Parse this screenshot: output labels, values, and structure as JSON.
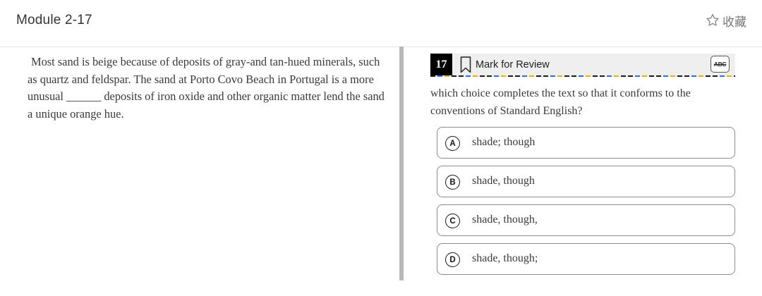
{
  "header": {
    "title": "Module 2-17",
    "favorite_label": "收藏",
    "favorite_icon": "star-outline-icon"
  },
  "passage": {
    "text": "Most sand is beige because of deposits of gray-and tan-hued minerals, such as quartz and feldspar. The sand at Porto Covo Beach in Portugal is a more unusual ______ deposits of iron oxide and other organic matter lend the sand a unique orange hue."
  },
  "question": {
    "number": "17",
    "mark_for_review_label": "Mark for Review",
    "bookmark_icon": "bookmark-outline-icon",
    "abc_label": "ABC",
    "abc_icon": "answer-eliminator-icon",
    "prompt": "which choice completes the text so that it conforms to the conventions of Standard English?",
    "dash_colors": [
      "#1a1a1a",
      "#2d6fcf",
      "#e0b300"
    ],
    "choices": [
      {
        "letter": "A",
        "text": "shade; though"
      },
      {
        "letter": "B",
        "text": "shade, though"
      },
      {
        "letter": "C",
        "text": "shade, though,"
      },
      {
        "letter": "D",
        "text": "shade, though;"
      }
    ]
  }
}
